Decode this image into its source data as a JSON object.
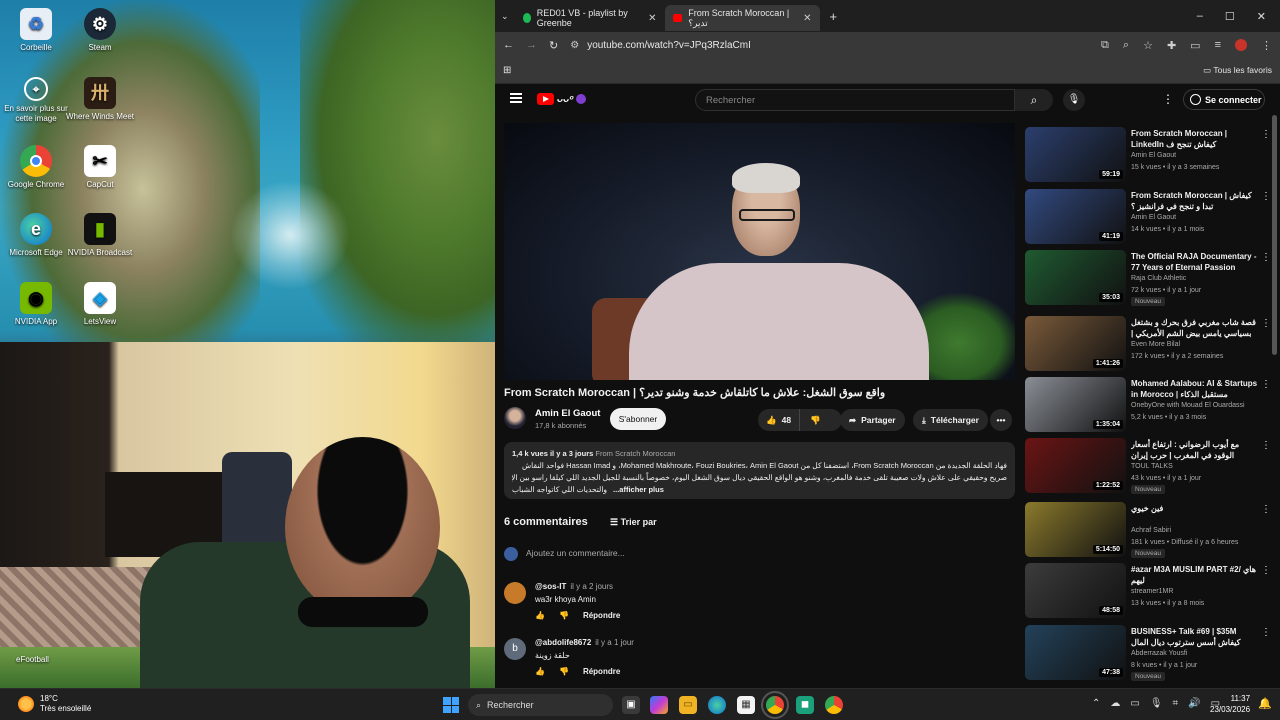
{
  "desktop": {
    "icons": [
      {
        "label": "Corbeille",
        "icon": "recycle-bin-icon"
      },
      {
        "label": "Steam",
        "icon": "steam-icon"
      },
      {
        "label": "En savoir plus sur cette image",
        "icon": "info-icon"
      },
      {
        "label": "Where Winds Meet",
        "icon": "game-icon"
      },
      {
        "label": "Google Chrome",
        "icon": "chrome-icon"
      },
      {
        "label": "CapCut",
        "icon": "capcut-icon"
      },
      {
        "label": "Microsoft Edge",
        "icon": "edge-icon"
      },
      {
        "label": "NVIDIA Broadcast",
        "icon": "nvidia-broadcast-icon"
      },
      {
        "label": "NVIDIA App",
        "icon": "nvidia-icon"
      },
      {
        "label": "LetsView",
        "icon": "letsview-icon"
      }
    ],
    "webcam_overlay_label": "eFootball"
  },
  "browser": {
    "tabs": [
      {
        "title": "RED01 VB - playlist by Greenbe",
        "icon": "spotify-icon",
        "active": false
      },
      {
        "title": "From Scratch Moroccan | تدير؟",
        "icon": "youtube-icon",
        "active": true
      }
    ],
    "new_tab": "+",
    "window_controls": [
      "–",
      "☐",
      "✕"
    ],
    "url": "youtube.com/watch?v=JPq3RzlaCmI",
    "bookmarks_right": "Tous les favoris"
  },
  "youtube": {
    "search_placeholder": "Rechercher",
    "signin_label": "Se connecter",
    "video": {
      "title": "From Scratch Moroccan | واقع سوق الشغل: علاش ما كاتلقاش خدمة وشنو تدير؟",
      "channel": "Amin El Gaout",
      "subscribers": "17,8 k abonnés",
      "subscribe_label": "S'abonner",
      "likes": "48",
      "share_label": "Partager",
      "download_label": "Télécharger",
      "more_label": "•••"
    },
    "description": {
      "views": "1,4 k vues",
      "date": "il y a 3 jours",
      "tag": "From Scratch Moroccan",
      "line1": "فهاد الحلقة الجديدة من From Scratch Moroccan، استضفنا كل من Mohamed Makhroute، Fouzi Boukries، Amin El Gaout، و Hassan Imad فواحد النقاش",
      "line2": "صريح وحقيقي على علاش ولات صعيبة تلقى خدمة فالمغرب، وشنو هو الواقع الحقيقي ديال سوق الشغل اليوم، خصوصاً بالنسبة للجيل الجديد اللي كيلقا راسو بين الإمكانيات الكبيرة",
      "line3": "والتحديات اللي كاتواجه الشباب",
      "more": "...afficher plus"
    },
    "comments": {
      "count_label": "6 commentaires",
      "sort_label": "Trier par",
      "add_placeholder": "Ajoutez un commentaire...",
      "items": [
        {
          "author": "@sos-IT",
          "time": "il y a 2 jours",
          "text": "wa3r khoya Amin",
          "reply": "Répondre",
          "avatar_color": "#c77b2a",
          "avatar_letter": ""
        },
        {
          "author": "@abdolife8672",
          "time": "il y a 1 jour",
          "text": "حلقة زوينة",
          "reply": "Répondre",
          "avatar_color": "#5f6b7a",
          "avatar_letter": "b"
        }
      ]
    },
    "recommendations": [
      {
        "title": "From Scratch Moroccan | LinkedIn كيفاش تنجح ف",
        "channel": "Amin El Gaout",
        "meta": "15 k vues • il y a 3 semaines",
        "duration": "59:19",
        "badge": "",
        "thumb": "#2b3f6e"
      },
      {
        "title": "From Scratch Moroccan | كيفاش تبدا و تنجح في فرانشيز ؟",
        "channel": "Amin El Gaout",
        "meta": "14 k vues • il y a 1 mois",
        "duration": "41:19",
        "badge": "",
        "thumb": "#324a80"
      },
      {
        "title": "The Official RAJA Documentary - 77 Years of Eternal Passion",
        "channel": "Raja Club Athletic",
        "meta": "72 k vues • il y a 1 jour",
        "duration": "35:03",
        "badge": "Nouveau",
        "thumb": "#1f5a31"
      },
      {
        "title": "قصة شاب مغربي فرق بحرك و بشتغل بسياسي يامس بيض الشم الأمريكي | تكلل بالنجاح",
        "channel": "Even More Bilal",
        "meta": "172 k vues • il y a 2 semaines",
        "duration": "1:41:26",
        "badge": "",
        "thumb": "#7a5a3a"
      },
      {
        "title": "Mohamed Aalabou: AI & Startups in Morocco | مستقبل الذكاء",
        "channel": "OnebyOne with Mouad El Ouardassi",
        "meta": "5,2 k vues • il y a 3 mois",
        "duration": "1:35:04",
        "badge": "",
        "thumb": "#8a8f96"
      },
      {
        "title": "مع أيوب الرضواني : ارتفاع أسعار الوقود في المغرب | حرب إيران وحقائق بالنسبة للمغرب",
        "channel": "TOUL TALKS",
        "meta": "43 k vues • il y a 1 jour",
        "duration": "1:22:52",
        "badge": "Nouveau",
        "thumb": "#6b1414"
      },
      {
        "title": "فين خيوي",
        "channel": "Achraf Sabiri",
        "meta": "181 k vues • Diffusé il y a 6 heures",
        "duration": "5:14:50",
        "badge": "Nouveau",
        "thumb": "#8a7a2c"
      },
      {
        "title": "#azar M3A MUSLIM PART #2/ هاي ليهم",
        "channel": "streamer1MR",
        "meta": "13 k vues • il y a 8 mois",
        "duration": "48:58",
        "badge": "",
        "thumb": "#3c3c3c"
      },
      {
        "title": "BUSINESS+ Talk #69 | $35M كيفاش أسس سترتوب ديال المال بقيمة",
        "channel": "Abderrazak Yousfi",
        "meta": "8 k vues • il y a 1 jour",
        "duration": "47:38",
        "badge": "Nouveau",
        "thumb": "#23425a"
      }
    ]
  },
  "taskbar": {
    "weather_temp": "18°C",
    "weather_desc": "Très ensoleillé",
    "search_label": "Rechercher",
    "time": "11:37",
    "date": "23/03/2026",
    "accent": "#3fa4ff"
  }
}
